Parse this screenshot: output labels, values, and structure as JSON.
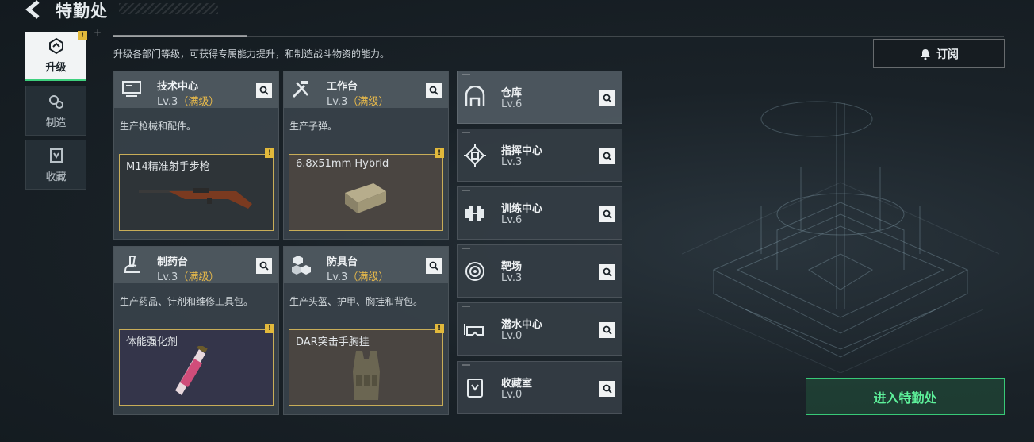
{
  "header": {
    "title": "特勤处"
  },
  "sidebar": {
    "tabs": [
      {
        "label": "升级",
        "icon": "upgrade-icon",
        "active": true,
        "badge": "!"
      },
      {
        "label": "制造",
        "icon": "gears-icon",
        "active": false
      },
      {
        "label": "收藏",
        "icon": "collection-icon",
        "active": false
      }
    ]
  },
  "description": "升级各部门等级，可获得专属能力提升，和制造战斗物资的能力。",
  "subscribe_button": {
    "label": "订阅",
    "icon": "bell-icon"
  },
  "facilities": [
    {
      "name": "技术中心",
      "level": "Lv.3",
      "maxed_label": "（满级）",
      "desc": "生产枪械和配件。",
      "product": "M14精准射手步枪",
      "badge": "!"
    },
    {
      "name": "工作台",
      "level": "Lv.3",
      "maxed_label": "（满级）",
      "desc": "生产子弹。",
      "product": "6.8x51mm Hybrid",
      "badge": "!"
    },
    {
      "name": "制药台",
      "level": "Lv.3",
      "maxed_label": "（满级）",
      "desc": "生产药品、针剂和维修工具包。",
      "product": "体能强化剂",
      "badge": "!"
    },
    {
      "name": "防具台",
      "level": "Lv.3",
      "maxed_label": "（满级）",
      "desc": "生产头盔、护甲、胸挂和背包。",
      "product": "DAR突击手胸挂",
      "badge": "!"
    }
  ],
  "departments": [
    {
      "name": "仓库",
      "level": "Lv.6",
      "icon": "warehouse-icon"
    },
    {
      "name": "指挥中心",
      "level": "Lv.3",
      "icon": "chip-icon"
    },
    {
      "name": "训练中心",
      "level": "Lv.6",
      "icon": "dumbbell-icon"
    },
    {
      "name": "靶场",
      "level": "Lv.3",
      "icon": "target-icon"
    },
    {
      "name": "潜水中心",
      "level": "Lv.0",
      "icon": "diving-mask-icon"
    },
    {
      "name": "收藏室",
      "level": "Lv.0",
      "icon": "collection-icon"
    }
  ],
  "enter_button": {
    "label": "进入特勤处"
  },
  "colors": {
    "accent_green": "#3fd07e",
    "badge_yellow": "#e2b93b",
    "maxed_gold": "#e6b84a"
  }
}
